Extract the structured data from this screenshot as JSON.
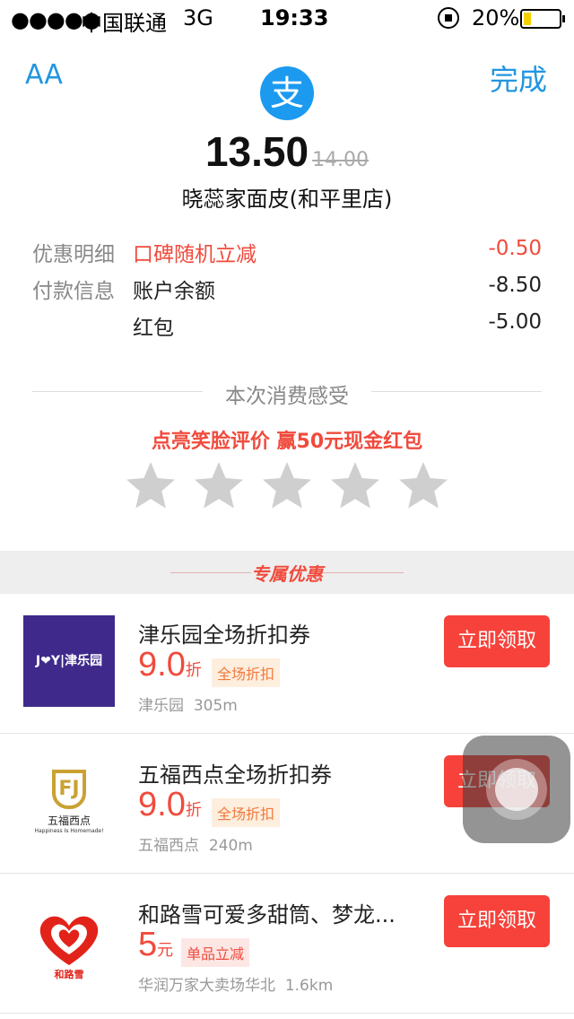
{
  "status_bar": {
    "signal": "●●●●●",
    "carrier": "中国联通",
    "network": "3G",
    "time": "19:33",
    "battery_pct": "20%",
    "battery_level": 0.2
  },
  "nav": {
    "left_label": "AA",
    "right_label": "完成"
  },
  "logo_char": "支",
  "payment": {
    "amount": "13.50",
    "original_amount": "14.00",
    "merchant": "晓蕊家面皮(和平里店)"
  },
  "details": [
    {
      "label": "优惠明细",
      "item": "口碑随机立减",
      "value": "-0.50"
    },
    {
      "label": "付款信息",
      "item": "账户余额",
      "value": "-8.50"
    },
    {
      "label": "",
      "item": "红包",
      "value": "-5.00"
    }
  ],
  "rating": {
    "section_title": "本次消费感受",
    "promo": "点亮笑脸评价 赢50元现金红包",
    "stars": 5,
    "star_color": "#cfcfcf"
  },
  "deals_header": "专属优惠",
  "deals": [
    {
      "title": "津乐园全场折扣券",
      "price": "9.0",
      "unit": "折",
      "tag": "全场折扣",
      "store": "津乐园",
      "distance": "305m",
      "button": "立即领取",
      "logo_text": "J❤Y|津乐园"
    },
    {
      "title": "五福西点全场折扣券",
      "price": "9.0",
      "unit": "折",
      "tag": "全场折扣",
      "store": "五福西点",
      "distance": "240m",
      "button": "立即领取",
      "logo_mark": "FJ",
      "logo_name": "五福西点",
      "logo_sub": "Happiness Is Homemade!"
    },
    {
      "title": "和路雪可爱多甜筒、梦龙...",
      "price": "5",
      "unit": "元",
      "tag": "单品立减",
      "store": "华润万家大卖场华北",
      "distance": "1.6km",
      "button": "立即领取",
      "logo_name": "和路雪"
    }
  ],
  "colors": {
    "accent_blue": "#2196e0",
    "accent_red": "#f04b3d",
    "button_red": "#f6423a"
  }
}
